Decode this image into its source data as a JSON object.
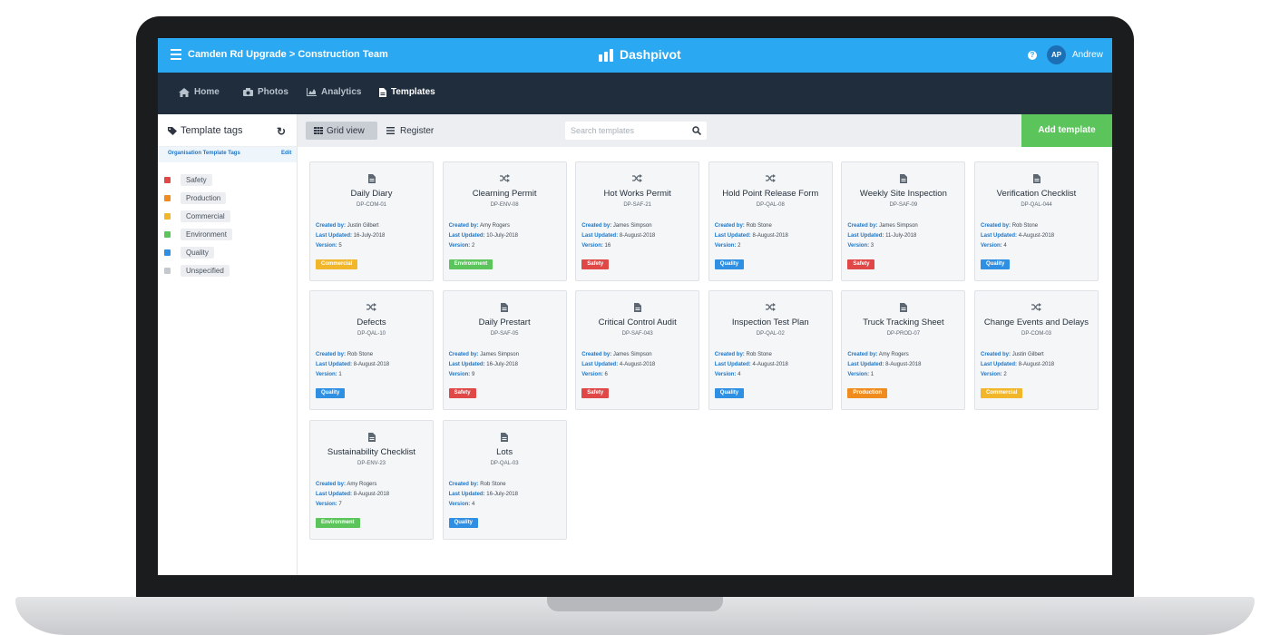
{
  "topbar": {
    "breadcrumb": "Camden Rd Upgrade > Construction Team",
    "brand": "Dashpivot",
    "help_icon": "?",
    "avatar_initials": "AP",
    "user_name": "Andrew"
  },
  "nav": {
    "items": [
      {
        "label": "Home",
        "icon": "home-icon"
      },
      {
        "label": "Photos",
        "icon": "camera-icon"
      },
      {
        "label": "Analytics",
        "icon": "area-chart-icon"
      },
      {
        "label": "Templates",
        "icon": "document-icon",
        "active": true
      }
    ]
  },
  "sidebar": {
    "title": "Template tags",
    "reset_icon": "↻",
    "org_label": "Organisation Template Tags",
    "edit_label": "Edit",
    "tags": [
      {
        "label": "Safety",
        "color": "#e04848"
      },
      {
        "label": "Production",
        "color": "#f08c1e"
      },
      {
        "label": "Commercial",
        "color": "#f2b62a"
      },
      {
        "label": "Environment",
        "color": "#5bc45b"
      },
      {
        "label": "Quality",
        "color": "#2e8fe3"
      },
      {
        "label": "Unspecified",
        "color": "#c4c9cf"
      }
    ]
  },
  "toolbar": {
    "grid_view_label": "Grid view",
    "register_label": "Register",
    "search_placeholder": "Search templates",
    "add_template_label": "Add template"
  },
  "labels": {
    "created_by": "Created by:",
    "last_updated": "Last Updated:",
    "version": "Version:"
  },
  "colors": {
    "Safety": "#e04848",
    "Production": "#f08c1e",
    "Commercial": "#f2b62a",
    "Environment": "#5bc45b",
    "Quality": "#2e8fe3"
  },
  "templates": [
    {
      "title": "Daily Diary",
      "code": "DP-COM-01",
      "icon": "document-icon",
      "created_by": "Justin Gilbert",
      "last_updated": "16-July-2018",
      "version": "5",
      "tag": "Commercial"
    },
    {
      "title": "Clearning Permit",
      "code": "DP-ENV-08",
      "icon": "shuffle-icon",
      "created_by": "Amy Rogers",
      "last_updated": "10-July-2018",
      "version": "2",
      "tag": "Environment"
    },
    {
      "title": "Hot Works Permit",
      "code": "DP-SAF-21",
      "icon": "shuffle-icon",
      "created_by": "James Simpson",
      "last_updated": "8-August-2018",
      "version": "16",
      "tag": "Safety"
    },
    {
      "title": "Hold Point Release Form",
      "code": "DP-QAL-08",
      "icon": "shuffle-icon",
      "created_by": "Rob Stone",
      "last_updated": "8-August-2018",
      "version": "2",
      "tag": "Quality"
    },
    {
      "title": "Weekly Site Inspection",
      "code": "DP-SAF-09",
      "icon": "document-icon",
      "created_by": "James Simpson",
      "last_updated": "11-July-2018",
      "version": "3",
      "tag": "Safety"
    },
    {
      "title": "Verification Checklist",
      "code": "DP-QAL-044",
      "icon": "document-icon",
      "created_by": "Rob Stone",
      "last_updated": "4-August-2018",
      "version": "4",
      "tag": "Quality"
    },
    {
      "title": "Defects",
      "code": "DP-QAL-10",
      "icon": "shuffle-icon",
      "created_by": "Rob Stone",
      "last_updated": "8-August-2018",
      "version": "1",
      "tag": "Quality"
    },
    {
      "title": "Daily Prestart",
      "code": "DP-SAF-05",
      "icon": "document-icon",
      "created_by": "James Simpson",
      "last_updated": "16-July-2018",
      "version": "9",
      "tag": "Safety"
    },
    {
      "title": "Critical Control Audit",
      "code": "DP-SAF-043",
      "icon": "document-icon",
      "created_by": "James Simpson",
      "last_updated": "4-August-2018",
      "version": "6",
      "tag": "Safety"
    },
    {
      "title": "Inspection Test Plan",
      "code": "DP-QAL-02",
      "icon": "shuffle-icon",
      "created_by": "Rob Stone",
      "last_updated": "4-August-2018",
      "version": "4",
      "tag": "Quality"
    },
    {
      "title": "Truck Tracking Sheet",
      "code": "DP-PROD-07",
      "icon": "document-icon",
      "created_by": "Amy Rogers",
      "last_updated": "8-August-2018",
      "version": "1",
      "tag": "Production"
    },
    {
      "title": "Change Events and Delays",
      "code": "DP-COM-03",
      "icon": "shuffle-icon",
      "created_by": "Justin Gilbert",
      "last_updated": "8-August-2018",
      "version": "2",
      "tag": "Commercial"
    },
    {
      "title": "Sustainability Checklist",
      "code": "DP-ENV-23",
      "icon": "document-icon",
      "created_by": "Amy Rogers",
      "last_updated": "8-August-2018",
      "version": "7",
      "tag": "Environment"
    },
    {
      "title": "Lots",
      "code": "DP-QAL-03",
      "icon": "document-icon",
      "created_by": "Rob Stone",
      "last_updated": "16-July-2018",
      "version": "4",
      "tag": "Quality"
    }
  ]
}
